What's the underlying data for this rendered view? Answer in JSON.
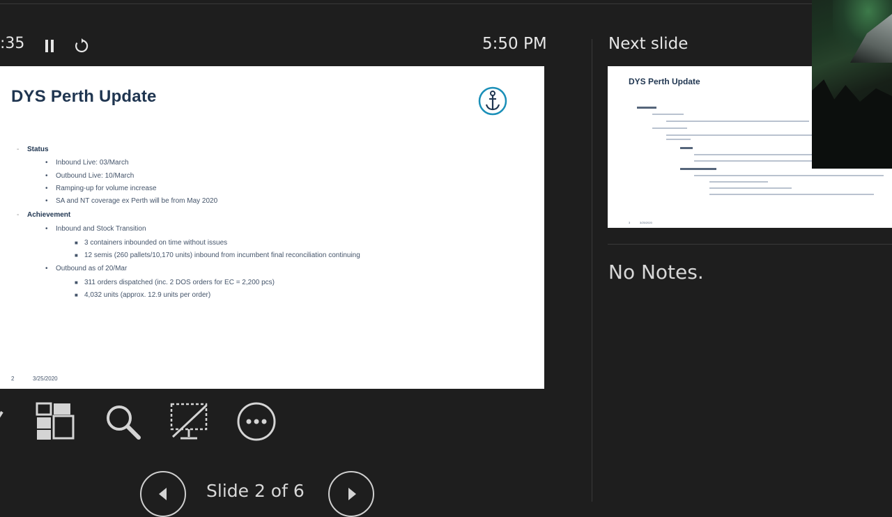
{
  "presenter": {
    "timer": ":35",
    "clock": "5:50 PM",
    "next_slide_label": "Next slide",
    "notes": "No Notes.",
    "slide_counter": "Slide 2 of 6"
  },
  "current_slide": {
    "title": "DYS Perth Update",
    "sections": [
      {
        "heading": "Status",
        "items": [
          {
            "text": "Inbound Live: 03/March"
          },
          {
            "text": "Outbound Live: 10/March"
          },
          {
            "text": "Ramping-up for volume increase"
          },
          {
            "text": "SA and NT coverage ex Perth will be from May 2020"
          }
        ]
      },
      {
        "heading": "Achievement",
        "items": [
          {
            "text": "Inbound and Stock Transition",
            "subitems": [
              "3 containers inbounded on time without issues",
              "12 semis (260 pallets/10,170 units) inbound from incumbent final reconciliation continuing"
            ]
          },
          {
            "text": "Outbound as of 20/Mar",
            "subitems": [
              "311 orders dispatched (inc. 2 DOS orders for EC = 2,200 pcs)",
              "4,032 units (approx. 12.9 units per order)"
            ]
          }
        ]
      }
    ],
    "footer_number": "2",
    "footer_date": "3/25/2020"
  },
  "next_slide": {
    "title": "DYS Perth Update",
    "footer_number": "3",
    "footer_date": "3/25/2020"
  },
  "colors": {
    "background": "#1e1e1e",
    "slide_title": "#1f3550",
    "slide_text": "#44546a",
    "logo": "#1a8fb8"
  },
  "icons": [
    "pause-icon",
    "restart-icon",
    "pen-icon",
    "slide-grid-icon",
    "zoom-icon",
    "black-screen-icon",
    "more-options-icon",
    "previous-slide-icon",
    "next-slide-icon",
    "anchor-logo"
  ]
}
